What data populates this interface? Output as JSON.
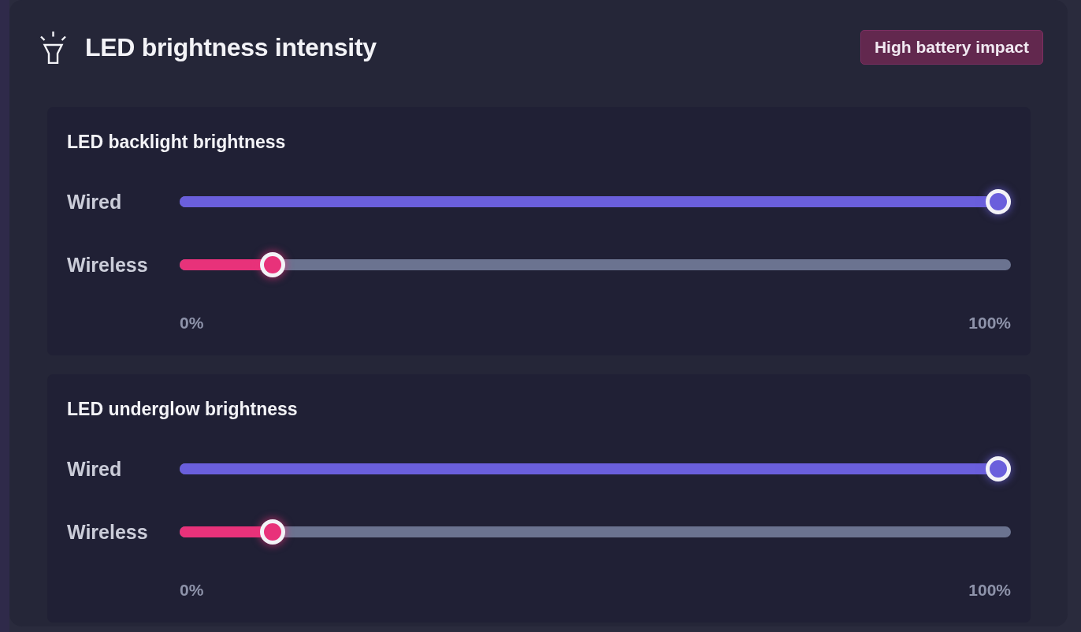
{
  "panel": {
    "title": "LED brightness intensity",
    "badge": "High battery impact"
  },
  "sections": [
    {
      "title": "LED backlight brightness",
      "sliders": [
        {
          "label": "Wired",
          "level": 1,
          "color": "#6a5fdc"
        },
        {
          "label": "Wireless",
          "level": 0.1,
          "color": "#e8327a"
        }
      ],
      "scale": {
        "min": "0%",
        "max": "100%"
      }
    },
    {
      "title": "LED underglow brightness",
      "sliders": [
        {
          "label": "Wired",
          "level": 1,
          "color": "#6a5fdc"
        },
        {
          "label": "Wireless",
          "level": 0.1,
          "color": "#e8327a"
        }
      ],
      "scale": {
        "min": "0%",
        "max": "100%"
      }
    }
  ]
}
